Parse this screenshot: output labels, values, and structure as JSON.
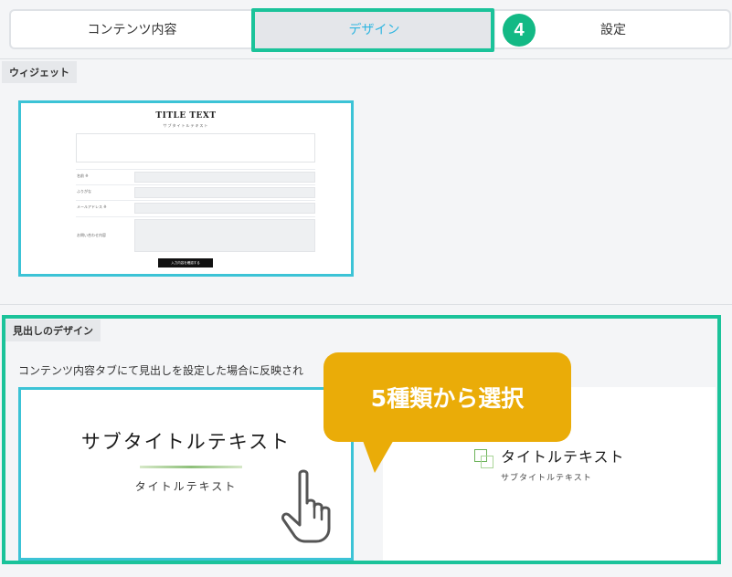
{
  "tabs": [
    {
      "label": "コンテンツ内容"
    },
    {
      "label": "デザイン",
      "active": true
    },
    {
      "label": "設定"
    }
  ],
  "step_badge": "4",
  "widget_section": {
    "label": "ウィジェット",
    "preview": {
      "title": "TITLE TEXT",
      "subtitle": "サブタイトルテキスト",
      "fields": [
        {
          "label": "名前 ※"
        },
        {
          "label": "ふりがな"
        },
        {
          "label": "メールアドレス ※"
        },
        {
          "label": "お問い合わせ内容"
        }
      ],
      "submit_label": "入力内容を確認する"
    }
  },
  "heading_section": {
    "label": "見出しのデザイン",
    "description": "コンテンツ内容タブにて見出しを設定した場合に反映され",
    "designs": [
      {
        "title": "サブタイトルテキスト",
        "subtitle": "タイトルテキスト"
      },
      {
        "title": "タイトルテキスト",
        "subtitle": "サブタイトルテキスト"
      }
    ]
  },
  "callout": {
    "text": "5種類から選択"
  },
  "colors": {
    "highlight": "#1bc39a",
    "selected_border": "#3cc3d6",
    "active_tab_text": "#2fb5e0",
    "callout": "#eaac08",
    "badge": "#13b985"
  },
  "icons": {
    "pointer": "hand-pointer-icon"
  }
}
